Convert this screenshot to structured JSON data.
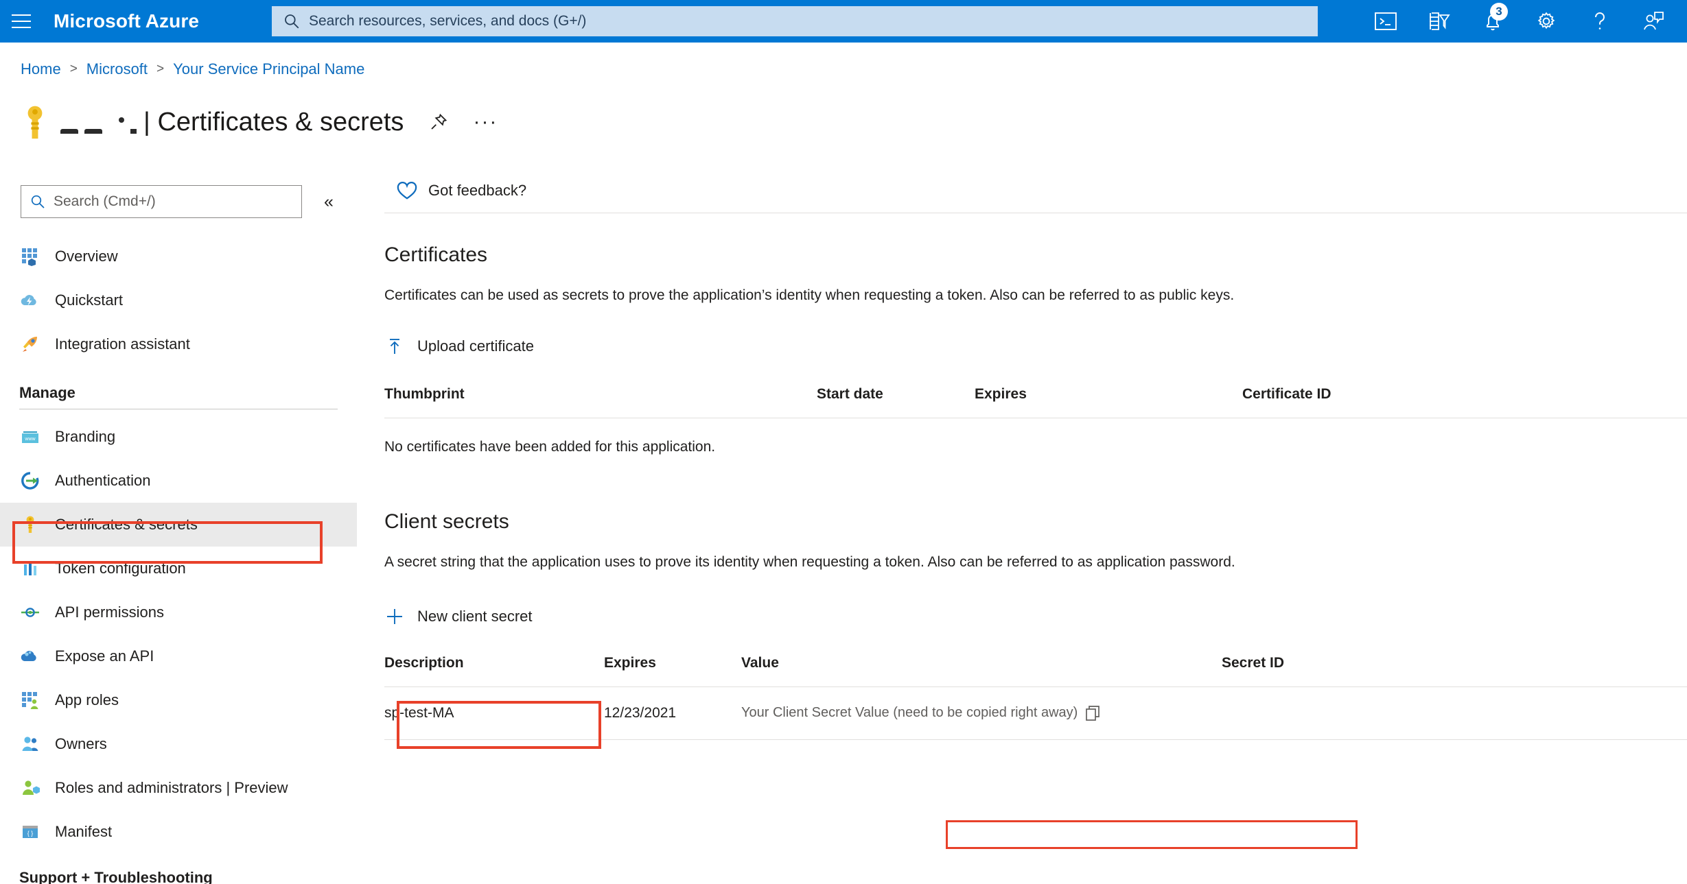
{
  "topbar": {
    "menu_label": "menu",
    "brand": "Microsoft Azure",
    "search_placeholder": "Search resources, services, and docs (G+/)",
    "icons": [
      {
        "name": "cloud-shell-icon",
        "label": "Cloud Shell"
      },
      {
        "name": "directories-filter-icon",
        "label": "Directories + subscriptions"
      },
      {
        "name": "notifications-bell-icon",
        "label": "Notifications",
        "badge": "3"
      },
      {
        "name": "settings-gear-icon",
        "label": "Settings"
      },
      {
        "name": "help-question-icon",
        "label": "Help"
      },
      {
        "name": "feedback-person-icon",
        "label": "Feedback"
      }
    ]
  },
  "breadcrumb": {
    "items": [
      "Home",
      "Microsoft",
      "Your Service Principal Name"
    ],
    "separator": ">"
  },
  "page": {
    "app_name_redacted": "",
    "separator": "|",
    "title": "Certificates & secrets",
    "pin_label": "Pin to dashboard",
    "more_label": "More"
  },
  "sidebar": {
    "search_placeholder": "Search (Cmd+/)",
    "collapse_label": "«",
    "items": [
      {
        "label": "Overview",
        "icon": "overview-grid-icon"
      },
      {
        "label": "Quickstart",
        "icon": "quickstart-cloud-icon"
      },
      {
        "label": "Integration assistant",
        "icon": "rocket-icon"
      }
    ],
    "manage_group": "Manage",
    "manage_items": [
      {
        "label": "Branding",
        "icon": "branding-browser-icon"
      },
      {
        "label": "Authentication",
        "icon": "authentication-arrow-icon"
      },
      {
        "label": "Certificates & secrets",
        "icon": "key-icon",
        "selected": true
      },
      {
        "label": "Token configuration",
        "icon": "token-bars-icon"
      },
      {
        "label": "API permissions",
        "icon": "api-permissions-icon"
      },
      {
        "label": "Expose an API",
        "icon": "expose-api-cloud-icon"
      },
      {
        "label": "App roles",
        "icon": "app-roles-icon"
      },
      {
        "label": "Owners",
        "icon": "owners-people-icon"
      },
      {
        "label": "Roles and administrators | Preview",
        "icon": "roles-admin-icon"
      },
      {
        "label": "Manifest",
        "icon": "manifest-braces-icon"
      }
    ],
    "support_group": "Support + Troubleshooting"
  },
  "main": {
    "feedback_label": "Got feedback?",
    "certificates": {
      "heading": "Certificates",
      "description": "Certificates can be used as secrets to prove the application’s identity when requesting a token. Also can be referred to as public keys.",
      "upload_button": "Upload certificate",
      "columns": [
        "Thumbprint",
        "Start date",
        "Expires",
        "Certificate ID"
      ],
      "empty_message": "No certificates have been added for this application.",
      "rows": []
    },
    "client_secrets": {
      "heading": "Client secrets",
      "description": "A secret string that the application uses to prove its identity when requesting a token. Also can be referred to as application password.",
      "new_button": "New client secret",
      "columns": [
        "Description",
        "Expires",
        "Value",
        "Secret ID"
      ],
      "rows": [
        {
          "description": "sp-test-MA",
          "expires": "12/23/2021",
          "value": "Your Client Secret Value (need to be copied right away)",
          "secret_id": "",
          "copy_label": "Copy to clipboard"
        }
      ]
    }
  },
  "annotations": {
    "color": "#e8412a",
    "boxes": [
      "certificates-and-secrets-nav-item",
      "new-client-secret-button",
      "client-secret-value"
    ]
  },
  "colors": {
    "azure_blue": "#0078d4",
    "link_blue": "#0f6cbd",
    "annotation_red": "#e8412a",
    "selected_gray": "#eaeaea"
  }
}
